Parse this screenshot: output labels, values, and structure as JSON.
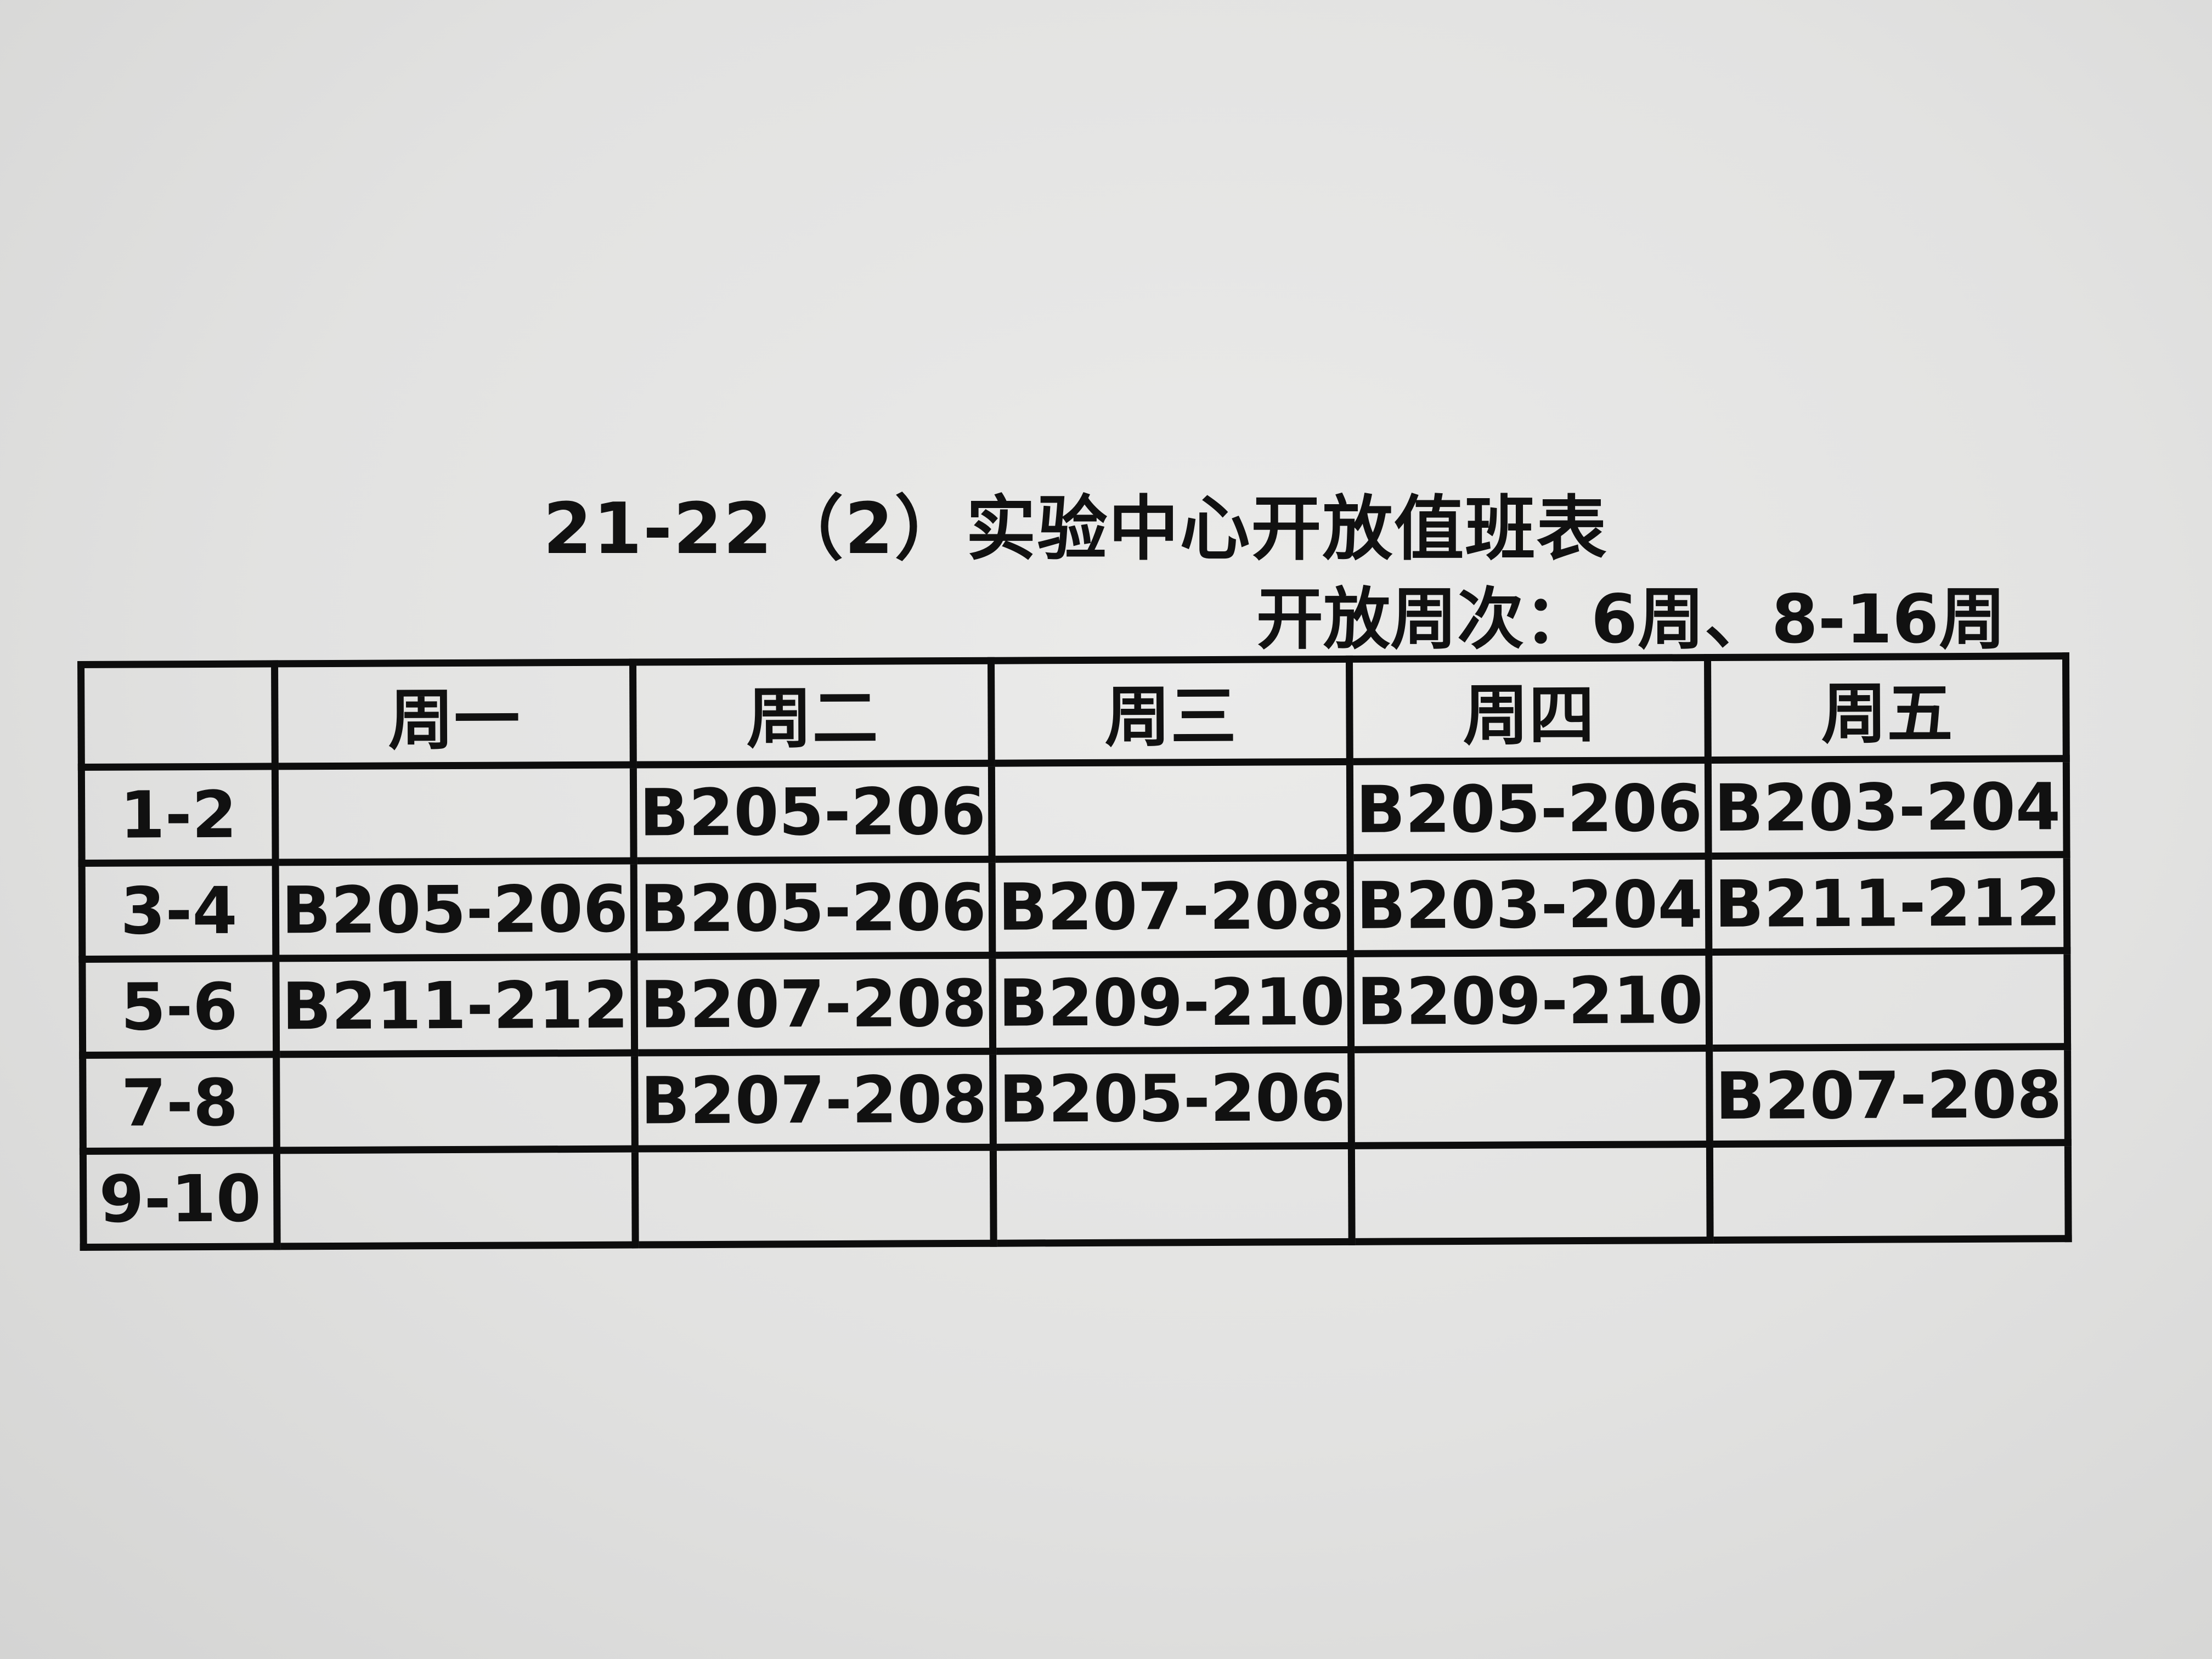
{
  "document": {
    "title": "21-22（2）实验中心开放值班表",
    "subtitle": "开放周次：6周、8-16周"
  },
  "table": {
    "columns": [
      "",
      "周一",
      "周二",
      "周三",
      "周四",
      "周五"
    ],
    "rows": [
      {
        "period": "1-2",
        "cells": [
          "",
          "B205-206",
          "",
          "B205-206",
          "B203-204"
        ]
      },
      {
        "period": "3-4",
        "cells": [
          "B205-206",
          "B205-206",
          "B207-208",
          "B203-204",
          "B211-212"
        ]
      },
      {
        "period": "5-6",
        "cells": [
          "B211-212",
          "B207-208",
          "B209-210",
          "B209-210",
          ""
        ]
      },
      {
        "period": "7-8",
        "cells": [
          "",
          "B207-208",
          "B205-206",
          "",
          "B207-208"
        ]
      },
      {
        "period": "9-10",
        "cells": [
          "",
          "",
          "",
          "",
          ""
        ]
      }
    ]
  }
}
